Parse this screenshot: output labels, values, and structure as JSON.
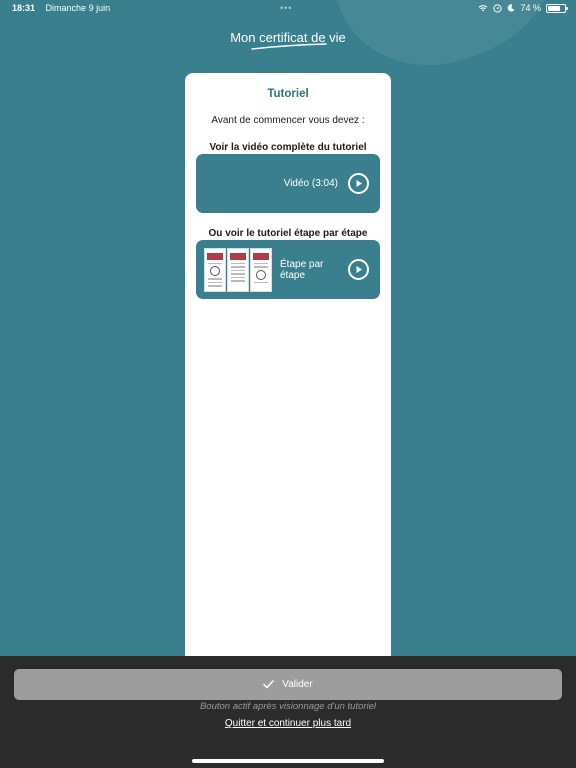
{
  "status_bar": {
    "time": "18:31",
    "date": "Dimanche 9 juin",
    "battery": "74 %",
    "battery_level": 0.74,
    "icons": [
      "wifi-icon",
      "location-icon",
      "moon-icon",
      "battery-icon"
    ]
  },
  "app": {
    "logo_text": "Mon certificat de vie"
  },
  "card": {
    "title": "Tutoriel",
    "intro": "Avant de commencer vous devez :",
    "video_section_title": "Voir la vidéo complète du tutoriel",
    "video_label": "Vidéo (3:04)",
    "steps_section_title": "Ou voir le tutoriel étape par étape",
    "steps_label": "Étape par étape"
  },
  "footer": {
    "validate_label": "Valider",
    "hint": "Bouton actif après visionnage d'un tutoriel",
    "later_link": "Quitter et continuer plus tard"
  },
  "colors": {
    "background": "#3a7f8e",
    "accent": "#2f7385",
    "bottom_bar": "#2b2b2b",
    "button_disabled": "#9d9d9d"
  }
}
